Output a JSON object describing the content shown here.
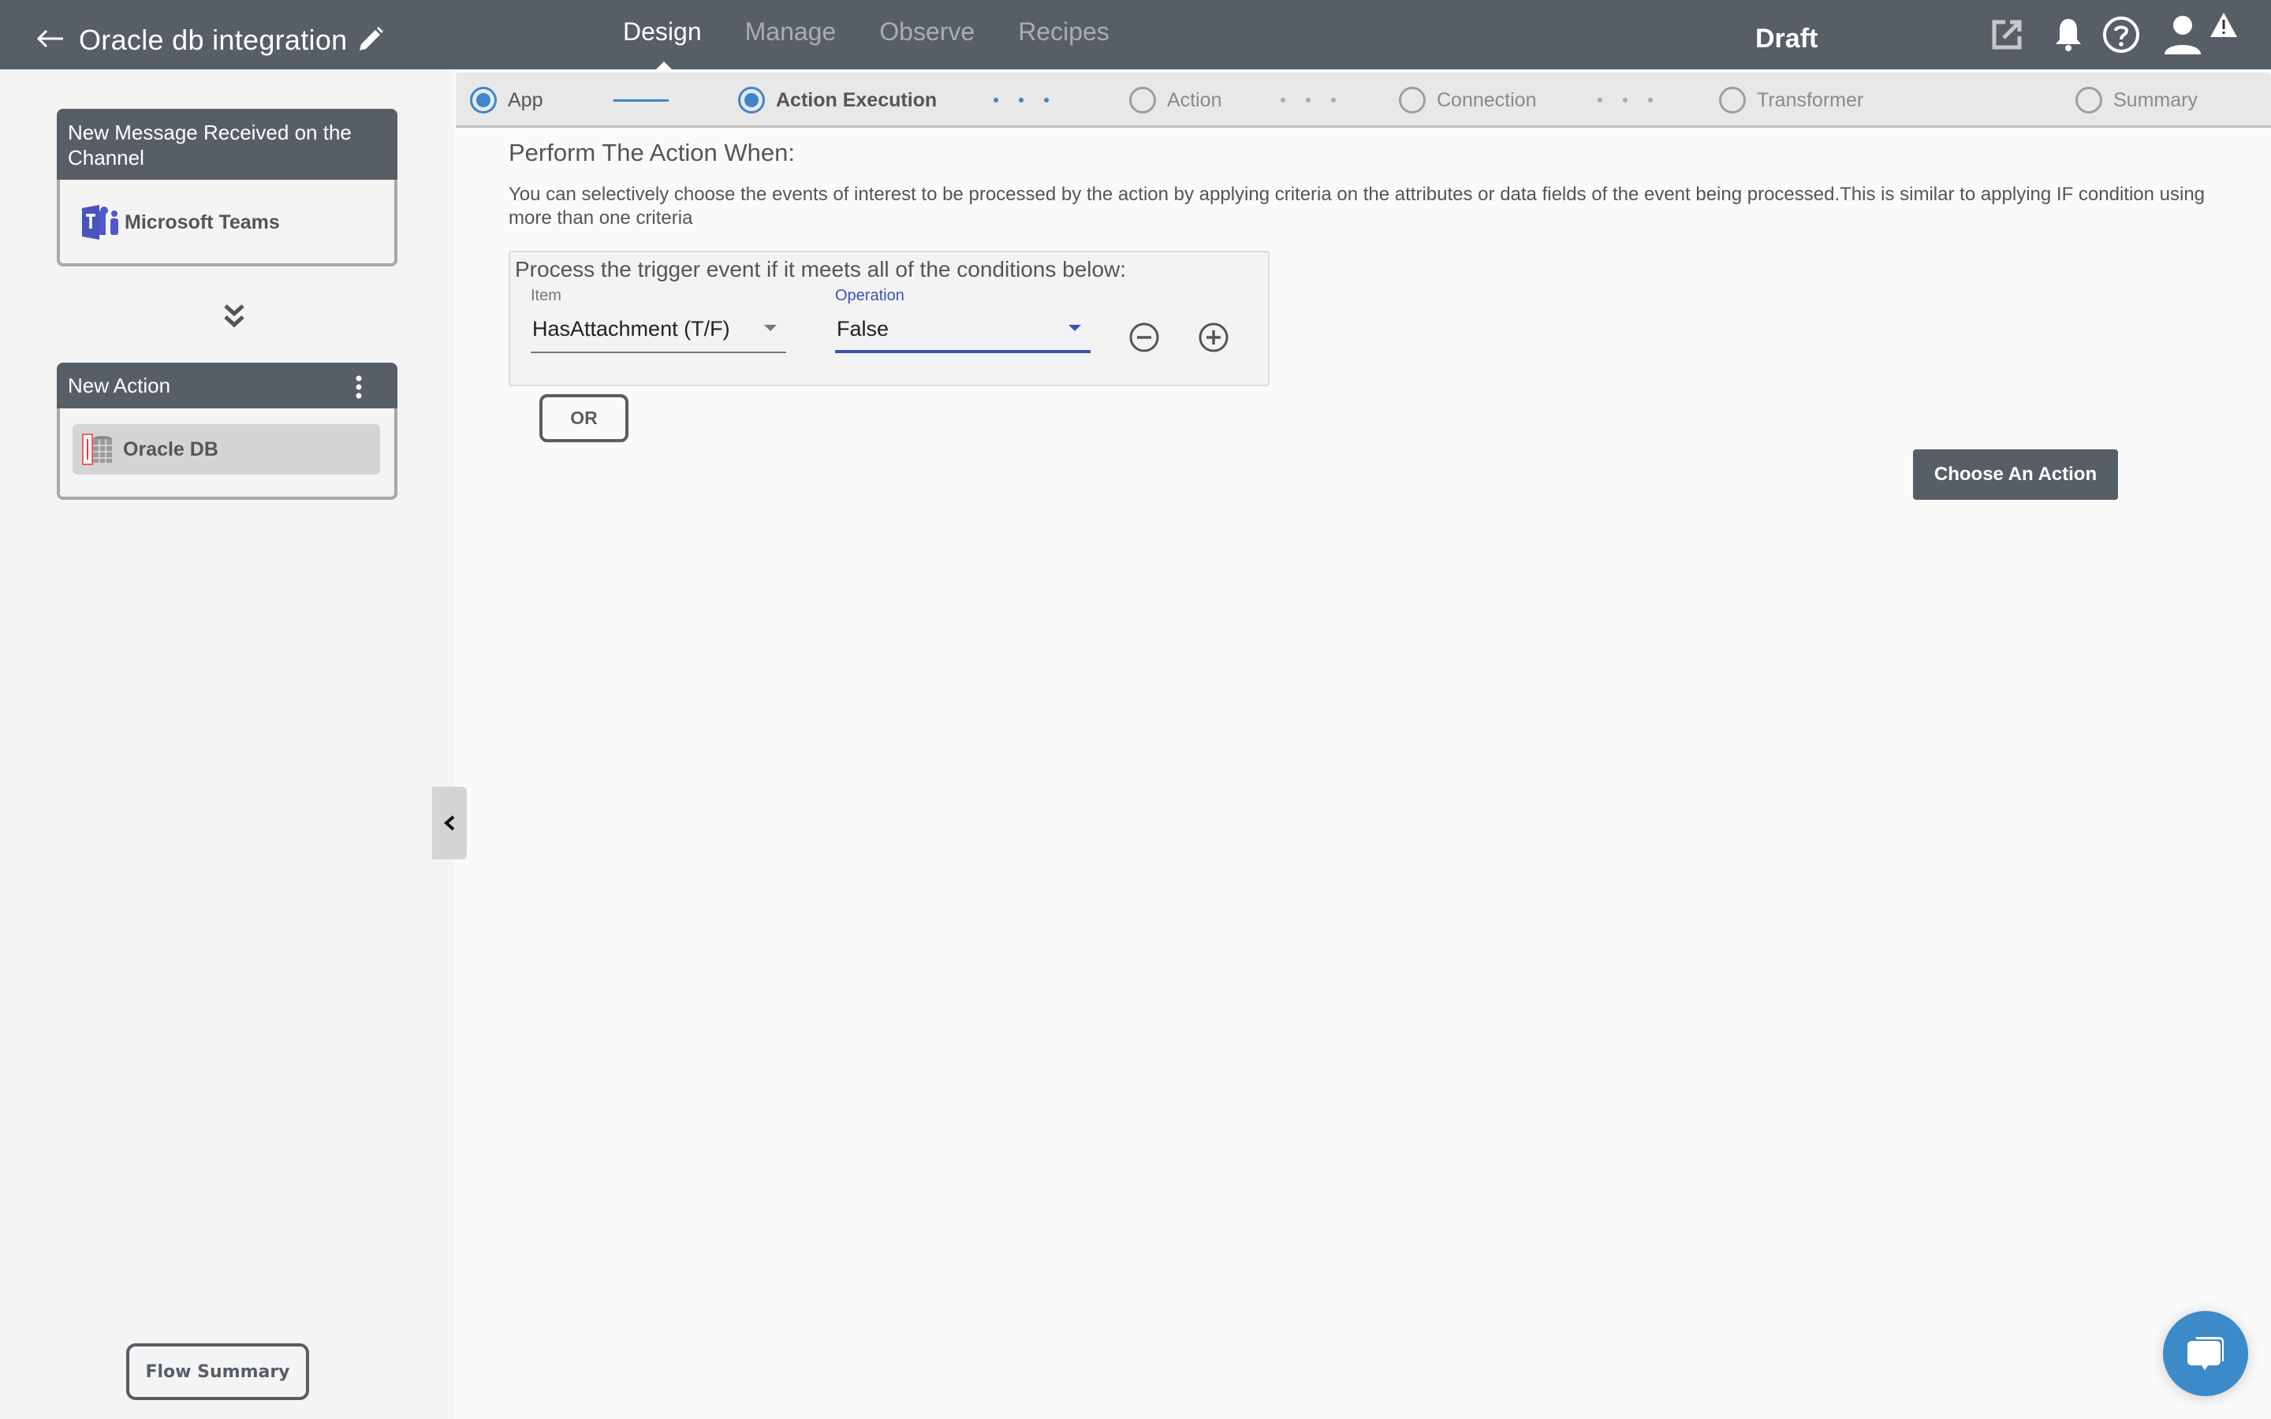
{
  "header": {
    "title": "Oracle db integration",
    "nav": [
      {
        "label": "Design",
        "active": true
      },
      {
        "label": "Manage",
        "active": false
      },
      {
        "label": "Observe",
        "active": false
      },
      {
        "label": "Recipes",
        "active": false
      }
    ],
    "status": "Draft",
    "icons": [
      "open-external-icon",
      "bell-icon",
      "help-icon",
      "user-icon",
      "warning-icon"
    ]
  },
  "sidebar": {
    "trigger_card": {
      "title": "New Message Received on the Channel",
      "app": "Microsoft Teams"
    },
    "action_card": {
      "title": "New Action",
      "app": "Oracle DB"
    },
    "flow_summary_label": "Flow Summary"
  },
  "stepper": {
    "steps": [
      {
        "label": "App",
        "state": "done"
      },
      {
        "label": "Action Execution",
        "state": "active"
      },
      {
        "label": "Action",
        "state": "pending"
      },
      {
        "label": "Connection",
        "state": "pending"
      },
      {
        "label": "Transformer",
        "state": "pending"
      },
      {
        "label": "Summary",
        "state": "pending"
      }
    ]
  },
  "main": {
    "title": "Perform The Action When:",
    "description": "You can selectively choose the events of interest to be processed by the action by applying criteria on the attributes or data fields of the event being processed.This is similar to applying IF condition using more than one criteria",
    "condition_group": {
      "heading": "Process the trigger event if it meets all of the conditions below:",
      "item_label": "Item",
      "item_value": "HasAttachment (T/F)",
      "operation_label": "Operation",
      "operation_value": "False"
    },
    "or_label": "OR",
    "choose_action_label": "Choose An Action"
  },
  "colors": {
    "header_bg": "#575e66",
    "accent_blue": "#3d87c8",
    "focus_indigo": "#3f51b5"
  }
}
